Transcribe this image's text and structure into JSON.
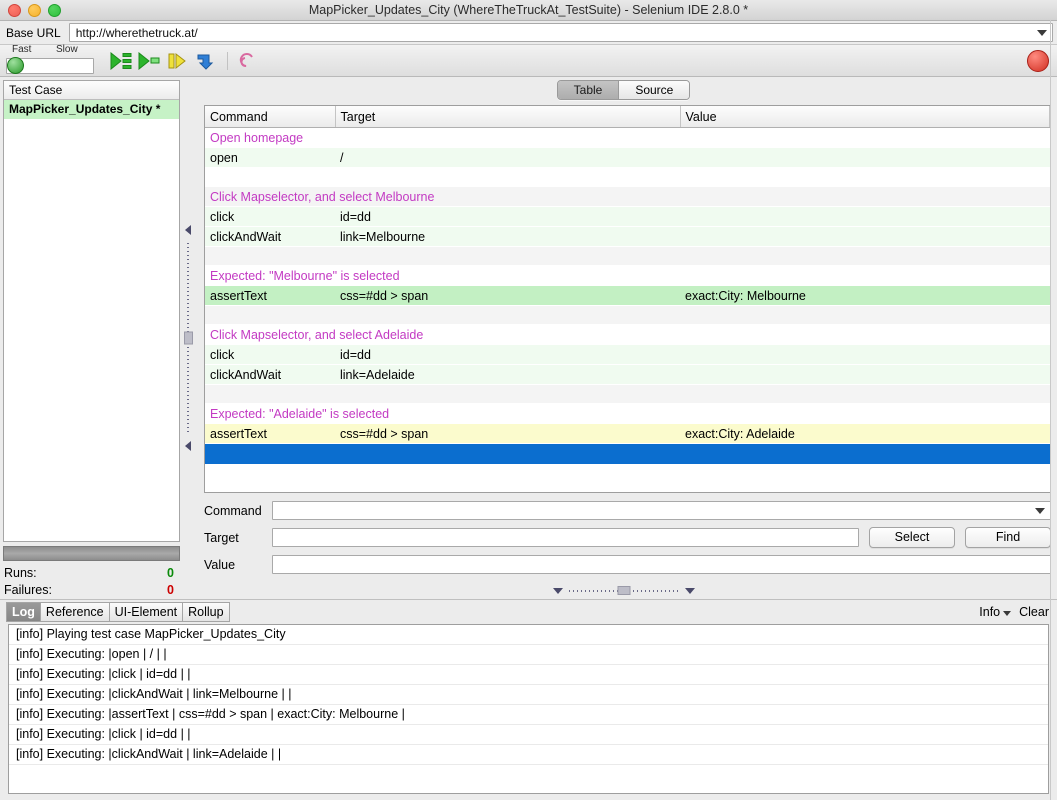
{
  "window": {
    "title": "MapPicker_Updates_City (WhereTheTruckAt_TestSuite) - Selenium IDE 2.8.0 *",
    "controls": [
      "close",
      "minimize",
      "zoom"
    ]
  },
  "base_url": {
    "label": "Base URL",
    "value": "http://wherethetruck.at/",
    "placeholder": ""
  },
  "toolbar": {
    "speed_fast_label": "Fast",
    "speed_slow_label": "Slow",
    "buttons": [
      {
        "name": "play-entire-test-suite",
        "icon": "play-suite-icon"
      },
      {
        "name": "play-current-test-case",
        "icon": "play-case-icon"
      },
      {
        "name": "pause-resume",
        "icon": "pause-icon"
      },
      {
        "name": "step",
        "icon": "step-icon"
      },
      {
        "name": "apply-rollup-rules",
        "icon": "rollup-icon"
      }
    ],
    "record_label": "record"
  },
  "left_panel": {
    "header": "Test Case",
    "items": [
      {
        "label": "MapPicker_Updates_City *",
        "selected": true
      }
    ],
    "stats": [
      {
        "label": "Runs:",
        "value": "0",
        "tone": "ok"
      },
      {
        "label": "Failures:",
        "value": "0",
        "tone": "bad"
      }
    ]
  },
  "view_tabs": [
    {
      "label": "Table",
      "active": true
    },
    {
      "label": "Source",
      "active": false
    }
  ],
  "command_table": {
    "columns": [
      "Command",
      "Target",
      "Value"
    ],
    "rows": [
      {
        "kind": "comment",
        "command": "Open homepage",
        "target": "",
        "value": ""
      },
      {
        "kind": "cmd",
        "state": "pending",
        "command": "open",
        "target": "/",
        "value": ""
      },
      {
        "kind": "blank",
        "command": "",
        "target": "",
        "value": ""
      },
      {
        "kind": "comment",
        "alt": true,
        "command": "Click Mapselector, and select Melbourne",
        "target": "",
        "value": ""
      },
      {
        "kind": "cmd",
        "state": "pending",
        "command": "click",
        "target": "id=dd",
        "value": ""
      },
      {
        "kind": "cmd",
        "state": "pending",
        "command": "clickAndWait",
        "target": "link=Melbourne",
        "value": ""
      },
      {
        "kind": "blank",
        "alt": true,
        "command": "",
        "target": "",
        "value": ""
      },
      {
        "kind": "comment",
        "command": "Expected: \"Melbourne\" is selected",
        "target": "",
        "value": ""
      },
      {
        "kind": "cmd",
        "state": "done",
        "command": "assertText",
        "target": "css=#dd > span",
        "value": "exact:City: Melbourne"
      },
      {
        "kind": "blank",
        "alt": true,
        "command": "",
        "target": "",
        "value": ""
      },
      {
        "kind": "comment",
        "command": "Click Mapselector, and select Adelaide",
        "target": "",
        "value": ""
      },
      {
        "kind": "cmd",
        "state": "pending",
        "command": "click",
        "target": "id=dd",
        "value": ""
      },
      {
        "kind": "cmd",
        "state": "pending",
        "command": "clickAndWait",
        "target": "link=Adelaide",
        "value": ""
      },
      {
        "kind": "blank",
        "alt": true,
        "command": "",
        "target": "",
        "value": ""
      },
      {
        "kind": "comment",
        "command": "Expected: \"Adelaide\" is selected",
        "target": "",
        "value": ""
      },
      {
        "kind": "cmd",
        "state": "running",
        "command": "assertText",
        "target": "css=#dd > span",
        "value": "exact:City: Adelaide"
      },
      {
        "kind": "selected",
        "command": "",
        "target": "",
        "value": ""
      },
      {
        "kind": "blank",
        "command": "",
        "target": "",
        "value": ""
      }
    ]
  },
  "command_form": {
    "command_label": "Command",
    "command_value": "",
    "target_label": "Target",
    "target_value": "",
    "value_label": "Value",
    "value_value": "",
    "select_button": "Select",
    "find_button": "Find"
  },
  "log_panel": {
    "tabs": [
      {
        "label": "Log",
        "active": true
      },
      {
        "label": "Reference",
        "active": false
      },
      {
        "label": "UI-Element",
        "active": false
      },
      {
        "label": "Rollup",
        "active": false
      }
    ],
    "level_label": "Info",
    "clear_label": "Clear",
    "lines": [
      "[info] Playing test case MapPicker_Updates_City",
      "[info] Executing: |open | / | |",
      "[info] Executing: |click | id=dd | |",
      "[info] Executing: |clickAndWait | link=Melbourne | |",
      "[info] Executing: |assertText | css=#dd > span | exact:City: Melbourne |",
      "[info] Executing: |click | id=dd | |",
      "[info] Executing: |clickAndWait | link=Adelaide | |"
    ]
  },
  "colors": {
    "comment": "#c33ac3",
    "row_pending": "#f0fbf0",
    "row_done": "#c3f0c3",
    "row_running": "#fbfbcd",
    "row_selected": "#0b6ecf",
    "runs_ok": "#0a8a0a",
    "failures_bad": "#cc0000",
    "testcase_selected": "#c6f2c6"
  }
}
